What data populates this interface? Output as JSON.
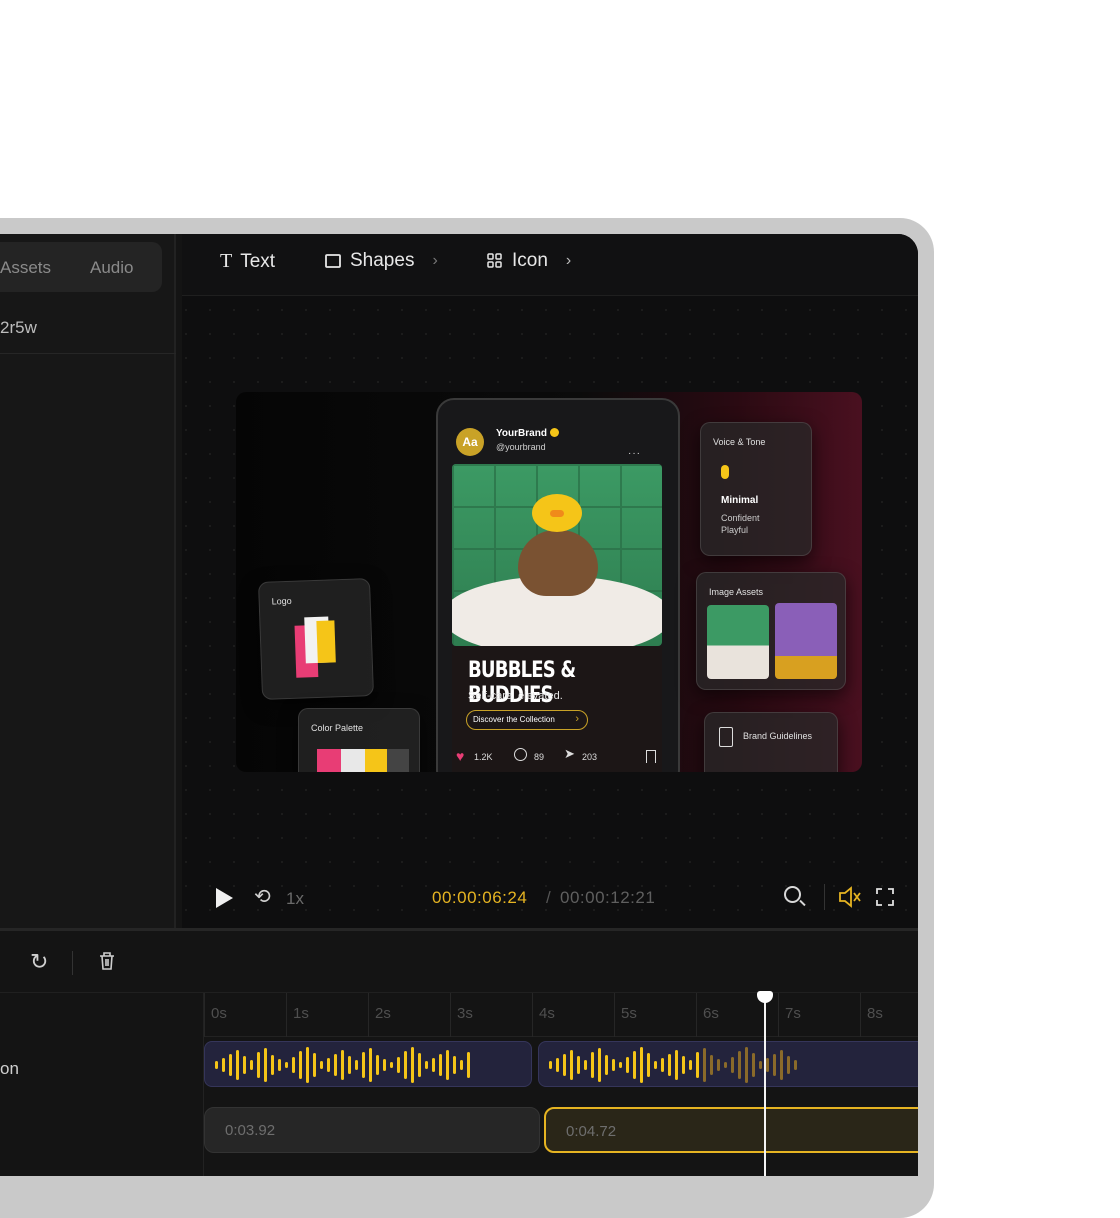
{
  "left_panel": {
    "tabs": [
      "Assets",
      "Audio"
    ],
    "row_text": "2r5w"
  },
  "toolbar": {
    "text_label": "Text",
    "shapes_label": "Shapes",
    "icon_label": "Icon"
  },
  "canvas": {
    "brand_name": "YourBrand",
    "brand_handle": "@yourbrand",
    "avatar_text": "Aa",
    "post_title": "BUBBLES & BUDDIES",
    "post_subtitle": "Self-care, elevated.",
    "post_cta": "Discover the Collection",
    "likes": "1.2K",
    "comments": "89",
    "shares": "203",
    "logo_card": "Logo",
    "palette_card": "Color Palette",
    "voice_card": "Voice & Tone",
    "voice_main": "Minimal",
    "voice_sub1": "Confident",
    "voice_sub2": "Playful",
    "image_assets_card": "Image Assets",
    "guidelines_card": "Brand Guidelines"
  },
  "player": {
    "speed": "1x",
    "current_time": "00:00:06:24",
    "separator": "/",
    "total_time": "00:00:12:21"
  },
  "timeline": {
    "ruler": [
      "0s",
      "1s",
      "2s",
      "3s",
      "4s",
      "5s",
      "6s",
      "7s",
      "8s"
    ],
    "track_label": "on",
    "clip1_duration": "0:03.92",
    "clip2_duration": "0:04.72"
  },
  "colors": {
    "accent": "#e6b422",
    "audio_clip": "#23233c",
    "background": "#141414"
  }
}
